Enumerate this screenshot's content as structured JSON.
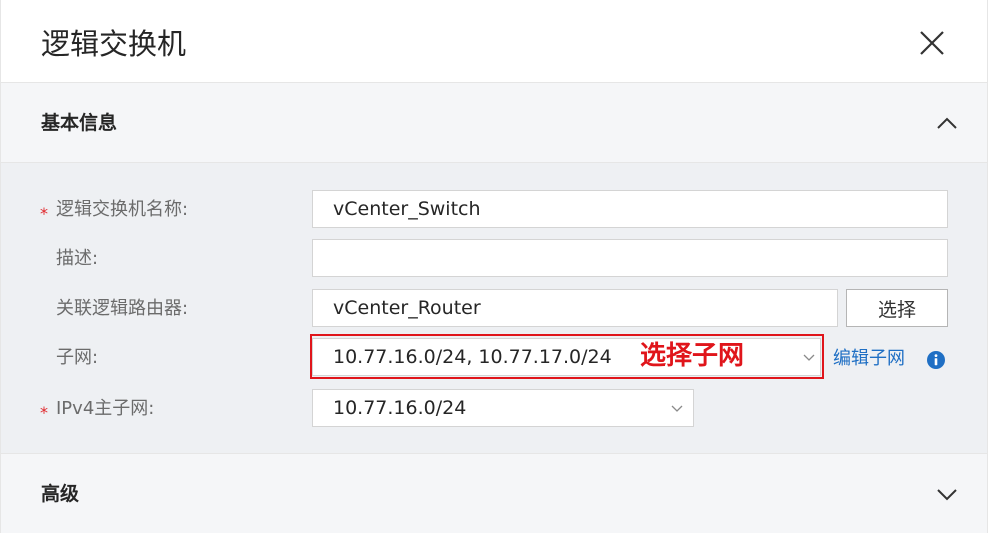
{
  "dialog": {
    "title": "逻辑交换机",
    "close_icon": "close-icon"
  },
  "sections": {
    "basic": {
      "title": "基本信息",
      "toggle_icon": "chevron-up-icon"
    },
    "advanced": {
      "title": "高级",
      "toggle_icon": "chevron-down-icon"
    }
  },
  "form": {
    "name": {
      "required_mark": "*",
      "label": "逻辑交换机名称:",
      "value": "vCenter_Switch"
    },
    "description": {
      "label": "描述:",
      "value": ""
    },
    "router": {
      "label": "关联逻辑路由器:",
      "value": "vCenter_Router",
      "button_label": "选择"
    },
    "subnet": {
      "label": "子网:",
      "value": "10.77.16.0/24, 10.77.17.0/24",
      "link_label": "编辑子网",
      "info_icon": "info-icon"
    },
    "ipv4_primary": {
      "required_mark": "*",
      "label": "IPv4主子网:",
      "value": "10.77.16.0/24"
    }
  },
  "annotation": {
    "text": "选择子网",
    "color": "#e0151b"
  },
  "colors": {
    "link": "#1f6fc4",
    "required": "#e0262b",
    "section_header_bg": "#f5f6f8",
    "section_body_bg": "#eef0f3",
    "info_icon": "#1f6fc4"
  }
}
